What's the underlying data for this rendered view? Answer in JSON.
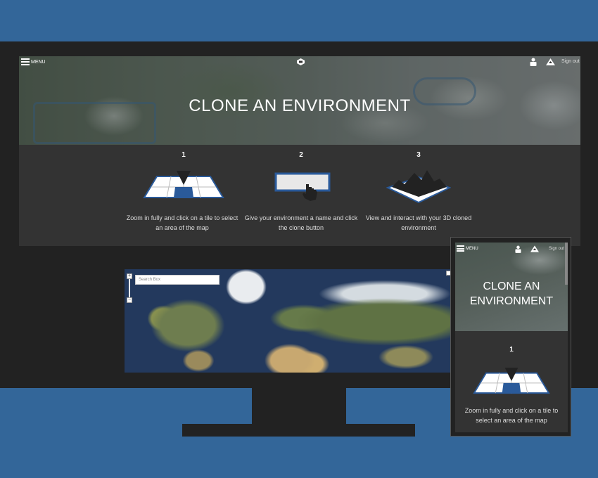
{
  "colors": {
    "background": "#336699",
    "device": "#222222",
    "panel": "#333333",
    "accent_blue": "#2a5a9a"
  },
  "desktop": {
    "nav": {
      "menu_label": "MENU",
      "sign_out_label": "Sign out",
      "menu_icon": "hamburger-icon",
      "logo_icon": "logo-icon",
      "user_icon": "user-icon",
      "environment_icon": "mountain-icon"
    },
    "hero_title": "CLONE AN ENVIRONMENT",
    "steps": [
      {
        "number": "1",
        "text": "Zoom in fully and click on a tile to select an area of the map",
        "icon": "map-tile-select-icon"
      },
      {
        "number": "2",
        "text": "Give your environment a name and click the clone button",
        "icon": "clone-button-click-icon"
      },
      {
        "number": "3",
        "text": "View and interact with your 3D cloned environment",
        "icon": "3d-terrain-icon"
      }
    ],
    "map": {
      "search_placeholder": "Search Box",
      "zoom_in_label": "+",
      "zoom_out_label": "−"
    }
  },
  "mobile": {
    "nav": {
      "menu_label": "MENU",
      "sign_out_label": "Sign out"
    },
    "hero_title_line1": "CLONE AN",
    "hero_title_line2": "ENVIRONMENT",
    "step": {
      "number": "1",
      "text": "Zoom in fully and click on a tile to select an area of the map"
    }
  }
}
